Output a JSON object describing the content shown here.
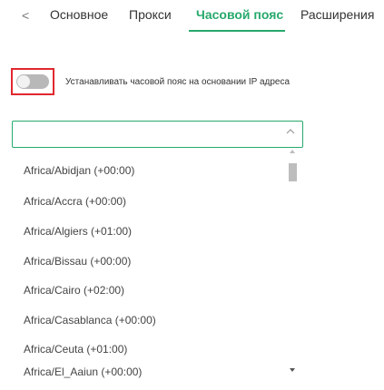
{
  "tabs": {
    "back_icon": "chevron-left-icon",
    "items": [
      {
        "label": "Основное",
        "active": false
      },
      {
        "label": "Прокси",
        "active": false
      },
      {
        "label": "Часовой пояс",
        "active": true
      },
      {
        "label": "Расширения",
        "active": false
      }
    ]
  },
  "timezone": {
    "auto_toggle_label": "Устанавливать часовой пояс на основании IP адреса",
    "auto_toggle_on": false,
    "select_value": "",
    "options": [
      "Africa/Abidjan (+00:00)",
      "Africa/Accra (+00:00)",
      "Africa/Algiers (+01:00)",
      "Africa/Bissau (+00:00)",
      "Africa/Cairo (+02:00)",
      "Africa/Casablanca (+00:00)",
      "Africa/Ceuta (+01:00)",
      "Africa/El_Aaiun (+00:00)"
    ]
  },
  "colors": {
    "accent": "#27a96c",
    "highlight_border": "#e0282f",
    "toggle_off": "#b8b8b8"
  }
}
